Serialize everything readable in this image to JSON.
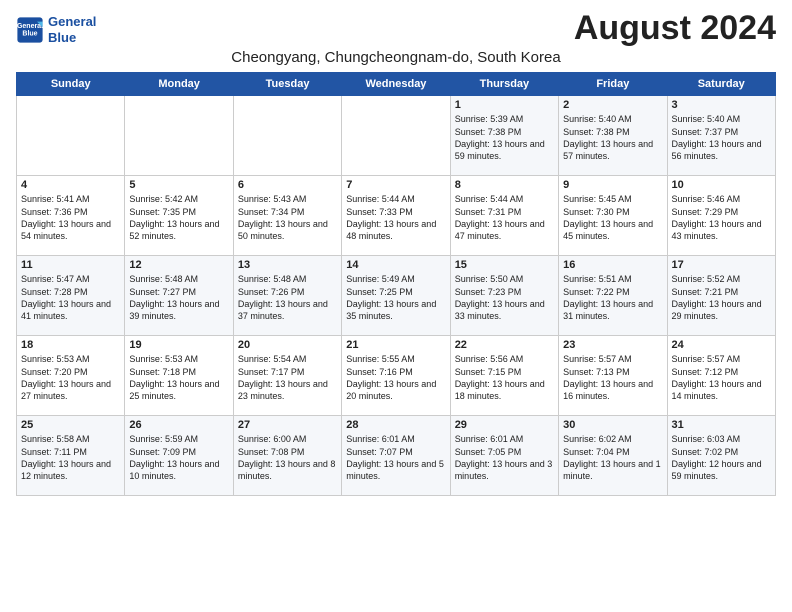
{
  "header": {
    "logo_line1": "General",
    "logo_line2": "Blue",
    "month_year": "August 2024",
    "location": "Cheongyang, Chungcheongnam-do, South Korea"
  },
  "weekdays": [
    "Sunday",
    "Monday",
    "Tuesday",
    "Wednesday",
    "Thursday",
    "Friday",
    "Saturday"
  ],
  "weeks": [
    [
      {
        "day": "",
        "content": ""
      },
      {
        "day": "",
        "content": ""
      },
      {
        "day": "",
        "content": ""
      },
      {
        "day": "",
        "content": ""
      },
      {
        "day": "1",
        "content": "Sunrise: 5:39 AM\nSunset: 7:38 PM\nDaylight: 13 hours\nand 59 minutes."
      },
      {
        "day": "2",
        "content": "Sunrise: 5:40 AM\nSunset: 7:38 PM\nDaylight: 13 hours\nand 57 minutes."
      },
      {
        "day": "3",
        "content": "Sunrise: 5:40 AM\nSunset: 7:37 PM\nDaylight: 13 hours\nand 56 minutes."
      }
    ],
    [
      {
        "day": "4",
        "content": "Sunrise: 5:41 AM\nSunset: 7:36 PM\nDaylight: 13 hours\nand 54 minutes."
      },
      {
        "day": "5",
        "content": "Sunrise: 5:42 AM\nSunset: 7:35 PM\nDaylight: 13 hours\nand 52 minutes."
      },
      {
        "day": "6",
        "content": "Sunrise: 5:43 AM\nSunset: 7:34 PM\nDaylight: 13 hours\nand 50 minutes."
      },
      {
        "day": "7",
        "content": "Sunrise: 5:44 AM\nSunset: 7:33 PM\nDaylight: 13 hours\nand 48 minutes."
      },
      {
        "day": "8",
        "content": "Sunrise: 5:44 AM\nSunset: 7:31 PM\nDaylight: 13 hours\nand 47 minutes."
      },
      {
        "day": "9",
        "content": "Sunrise: 5:45 AM\nSunset: 7:30 PM\nDaylight: 13 hours\nand 45 minutes."
      },
      {
        "day": "10",
        "content": "Sunrise: 5:46 AM\nSunset: 7:29 PM\nDaylight: 13 hours\nand 43 minutes."
      }
    ],
    [
      {
        "day": "11",
        "content": "Sunrise: 5:47 AM\nSunset: 7:28 PM\nDaylight: 13 hours\nand 41 minutes."
      },
      {
        "day": "12",
        "content": "Sunrise: 5:48 AM\nSunset: 7:27 PM\nDaylight: 13 hours\nand 39 minutes."
      },
      {
        "day": "13",
        "content": "Sunrise: 5:48 AM\nSunset: 7:26 PM\nDaylight: 13 hours\nand 37 minutes."
      },
      {
        "day": "14",
        "content": "Sunrise: 5:49 AM\nSunset: 7:25 PM\nDaylight: 13 hours\nand 35 minutes."
      },
      {
        "day": "15",
        "content": "Sunrise: 5:50 AM\nSunset: 7:23 PM\nDaylight: 13 hours\nand 33 minutes."
      },
      {
        "day": "16",
        "content": "Sunrise: 5:51 AM\nSunset: 7:22 PM\nDaylight: 13 hours\nand 31 minutes."
      },
      {
        "day": "17",
        "content": "Sunrise: 5:52 AM\nSunset: 7:21 PM\nDaylight: 13 hours\nand 29 minutes."
      }
    ],
    [
      {
        "day": "18",
        "content": "Sunrise: 5:53 AM\nSunset: 7:20 PM\nDaylight: 13 hours\nand 27 minutes."
      },
      {
        "day": "19",
        "content": "Sunrise: 5:53 AM\nSunset: 7:18 PM\nDaylight: 13 hours\nand 25 minutes."
      },
      {
        "day": "20",
        "content": "Sunrise: 5:54 AM\nSunset: 7:17 PM\nDaylight: 13 hours\nand 23 minutes."
      },
      {
        "day": "21",
        "content": "Sunrise: 5:55 AM\nSunset: 7:16 PM\nDaylight: 13 hours\nand 20 minutes."
      },
      {
        "day": "22",
        "content": "Sunrise: 5:56 AM\nSunset: 7:15 PM\nDaylight: 13 hours\nand 18 minutes."
      },
      {
        "day": "23",
        "content": "Sunrise: 5:57 AM\nSunset: 7:13 PM\nDaylight: 13 hours\nand 16 minutes."
      },
      {
        "day": "24",
        "content": "Sunrise: 5:57 AM\nSunset: 7:12 PM\nDaylight: 13 hours\nand 14 minutes."
      }
    ],
    [
      {
        "day": "25",
        "content": "Sunrise: 5:58 AM\nSunset: 7:11 PM\nDaylight: 13 hours\nand 12 minutes."
      },
      {
        "day": "26",
        "content": "Sunrise: 5:59 AM\nSunset: 7:09 PM\nDaylight: 13 hours\nand 10 minutes."
      },
      {
        "day": "27",
        "content": "Sunrise: 6:00 AM\nSunset: 7:08 PM\nDaylight: 13 hours\nand 8 minutes."
      },
      {
        "day": "28",
        "content": "Sunrise: 6:01 AM\nSunset: 7:07 PM\nDaylight: 13 hours\nand 5 minutes."
      },
      {
        "day": "29",
        "content": "Sunrise: 6:01 AM\nSunset: 7:05 PM\nDaylight: 13 hours\nand 3 minutes."
      },
      {
        "day": "30",
        "content": "Sunrise: 6:02 AM\nSunset: 7:04 PM\nDaylight: 13 hours\nand 1 minute."
      },
      {
        "day": "31",
        "content": "Sunrise: 6:03 AM\nSunset: 7:02 PM\nDaylight: 12 hours\nand 59 minutes."
      }
    ]
  ]
}
